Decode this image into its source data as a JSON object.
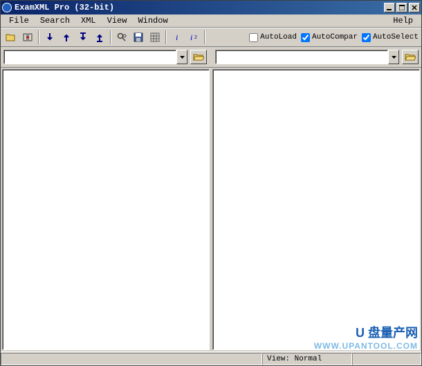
{
  "title": "ExamXML Pro (32-bit)",
  "menu": {
    "file": "File",
    "search": "Search",
    "xml": "XML",
    "view": "View",
    "window": "Window",
    "help": "Help"
  },
  "toolbar": {
    "checks": {
      "autoload": {
        "label": "AutoLoad",
        "checked": false
      },
      "autocompare": {
        "label": "AutoCompar",
        "checked": true
      },
      "autoselect": {
        "label": "AutoSelect",
        "checked": true
      }
    }
  },
  "filebar": {
    "left": {
      "value": ""
    },
    "right": {
      "value": ""
    }
  },
  "status": {
    "view_label": "View:",
    "view_value": "Normal"
  },
  "watermark": {
    "line1": "U 盘量产网",
    "line2": "WWW.UPANTOOL.COM"
  }
}
